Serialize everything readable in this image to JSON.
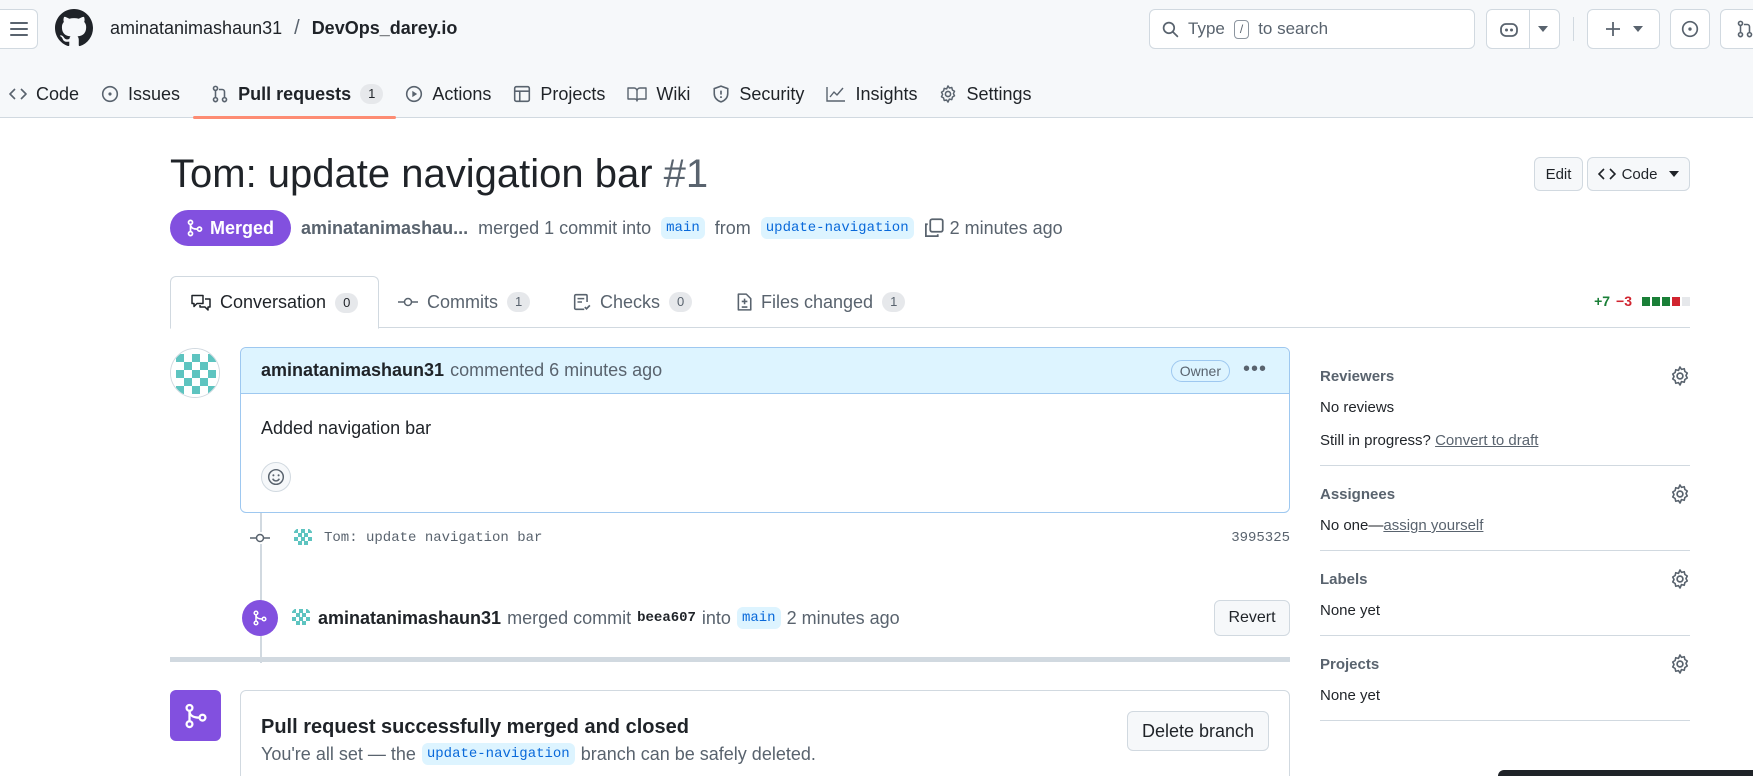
{
  "header": {
    "owner": "aminatanimashaun31",
    "separator": "/",
    "repo": "DevOps_darey.io",
    "search": {
      "before": "Type",
      "key": "/",
      "after": "to search"
    }
  },
  "repo_nav": {
    "tabs": [
      {
        "label": "Code",
        "icon": "code-icon"
      },
      {
        "label": "Issues",
        "icon": "issue-icon"
      },
      {
        "label": "Pull requests",
        "icon": "pull-request-icon",
        "count": "1",
        "active": true
      },
      {
        "label": "Actions",
        "icon": "play-icon"
      },
      {
        "label": "Projects",
        "icon": "table-icon"
      },
      {
        "label": "Wiki",
        "icon": "book-icon"
      },
      {
        "label": "Security",
        "icon": "shield-icon"
      },
      {
        "label": "Insights",
        "icon": "graph-icon"
      },
      {
        "label": "Settings",
        "icon": "gear-icon"
      }
    ]
  },
  "pr": {
    "title": "Tom: update navigation bar",
    "number": "#1",
    "edit_label": "Edit",
    "code_label": "Code",
    "status": "Merged",
    "author": "aminatanimashau...",
    "merged_text": "merged 1 commit into",
    "base_branch": "main",
    "from_text": "from",
    "head_branch": "update-navigation",
    "time": "2 minutes ago"
  },
  "pr_tabs": {
    "conversation": {
      "label": "Conversation",
      "count": "0"
    },
    "commits": {
      "label": "Commits",
      "count": "1"
    },
    "checks": {
      "label": "Checks",
      "count": "0"
    },
    "files": {
      "label": "Files changed",
      "count": "1"
    },
    "diff_add": "+7",
    "diff_del": "−3"
  },
  "comment": {
    "author": "aminatanimashaun31",
    "action": "commented 6 minutes ago",
    "badge": "Owner",
    "body": "Added navigation bar"
  },
  "commit": {
    "message": "Tom: update navigation bar",
    "sha": "3995325"
  },
  "merge_event": {
    "author": "aminatanimashaun31",
    "text1": "merged commit",
    "sha": "beea607",
    "text2": "into",
    "branch": "main",
    "time": "2 minutes ago",
    "revert_label": "Revert"
  },
  "merge_box": {
    "title": "Pull request successfully merged and closed",
    "sub_before": "You're all set — the",
    "branch": "update-navigation",
    "sub_after": "branch can be safely deleted.",
    "delete_label": "Delete branch"
  },
  "sidebar": {
    "reviewers": {
      "title": "Reviewers",
      "value": "No reviews",
      "draft_q": "Still in progress?",
      "draft_link": "Convert to draft"
    },
    "assignees": {
      "title": "Assignees",
      "value": "No one—",
      "link": "assign yourself"
    },
    "labels": {
      "title": "Labels",
      "value": "None yet"
    },
    "projects": {
      "title": "Projects",
      "value": "None yet"
    }
  },
  "colors": {
    "merged": "#8250df",
    "accent_underline": "#fd8c73",
    "diff_add": "#1a7f37",
    "diff_del": "#d1242f",
    "branch_bg": "#ddf4ff",
    "branch_fg": "#0969da"
  }
}
